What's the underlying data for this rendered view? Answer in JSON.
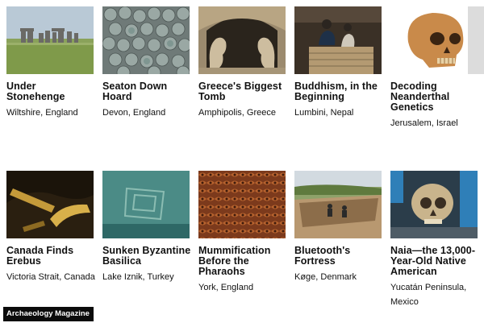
{
  "row1": [
    {
      "title": "Under Stonehenge",
      "location": "Wiltshire, England"
    },
    {
      "title": "Seaton Down Hoard",
      "location": "Devon, England"
    },
    {
      "title": "Greece's Biggest Tomb",
      "location": "Amphipolis, Greece"
    },
    {
      "title": "Buddhism, in the Beginning",
      "location": "Lumbini, Nepal"
    },
    {
      "title": "Decoding Neanderthal Genetics",
      "location": "Jerusalem, Israel"
    }
  ],
  "row2": [
    {
      "title": "Canada Finds Erebus",
      "location": "Victoria Strait, Canada"
    },
    {
      "title": "Sunken Byzantine Basilica",
      "location": "Lake Iznik, Turkey"
    },
    {
      "title": "Mummification Before the Pharaohs",
      "location": "York, England"
    },
    {
      "title": "Bluetooth's Fortress",
      "location": "Køge, Denmark"
    },
    {
      "title": "Naia—the 13,000-Year-Old Native American",
      "location": "Yucatán Peninsula, Mexico"
    }
  ],
  "brand": "Archaeology Magazine"
}
